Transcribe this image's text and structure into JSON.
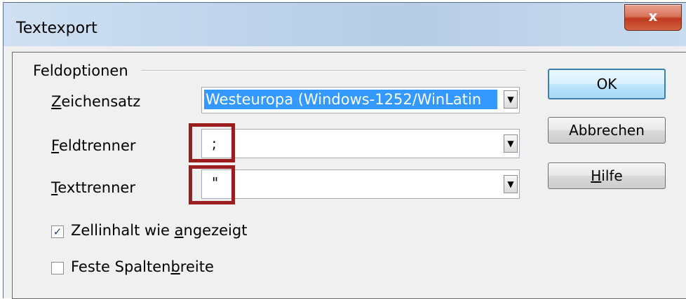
{
  "window": {
    "title": "Textexport",
    "close_label": "x"
  },
  "group": {
    "label": "Feldoptionen"
  },
  "fields": {
    "charset": {
      "label_pre": "",
      "label_key": "Z",
      "label_post": "eichensatz",
      "value": "Westeuropa (Windows-1252/WinLatin"
    },
    "field_sep": {
      "label_key": "F",
      "label_post": "eldtrenner",
      "value": ";"
    },
    "text_sep": {
      "label_key": "T",
      "label_post": "exttrenner",
      "value": "\""
    }
  },
  "checks": {
    "cell_content": {
      "checked": true,
      "label_pre": "Zellinhalt wie ",
      "label_key": "a",
      "label_post": "ngezeigt"
    },
    "fixed_width": {
      "checked": false,
      "label_pre": "Feste Spalten",
      "label_key": "b",
      "label_post": "reite"
    }
  },
  "buttons": {
    "ok": "OK",
    "cancel": "Abbrechen",
    "help_key": "H",
    "help_post": "ilfe"
  },
  "icons": {
    "dropdown": "chevron-down-icon",
    "check": "check-icon"
  },
  "colors": {
    "highlight": "#3399ff",
    "annotation": "#9b1d1d"
  }
}
